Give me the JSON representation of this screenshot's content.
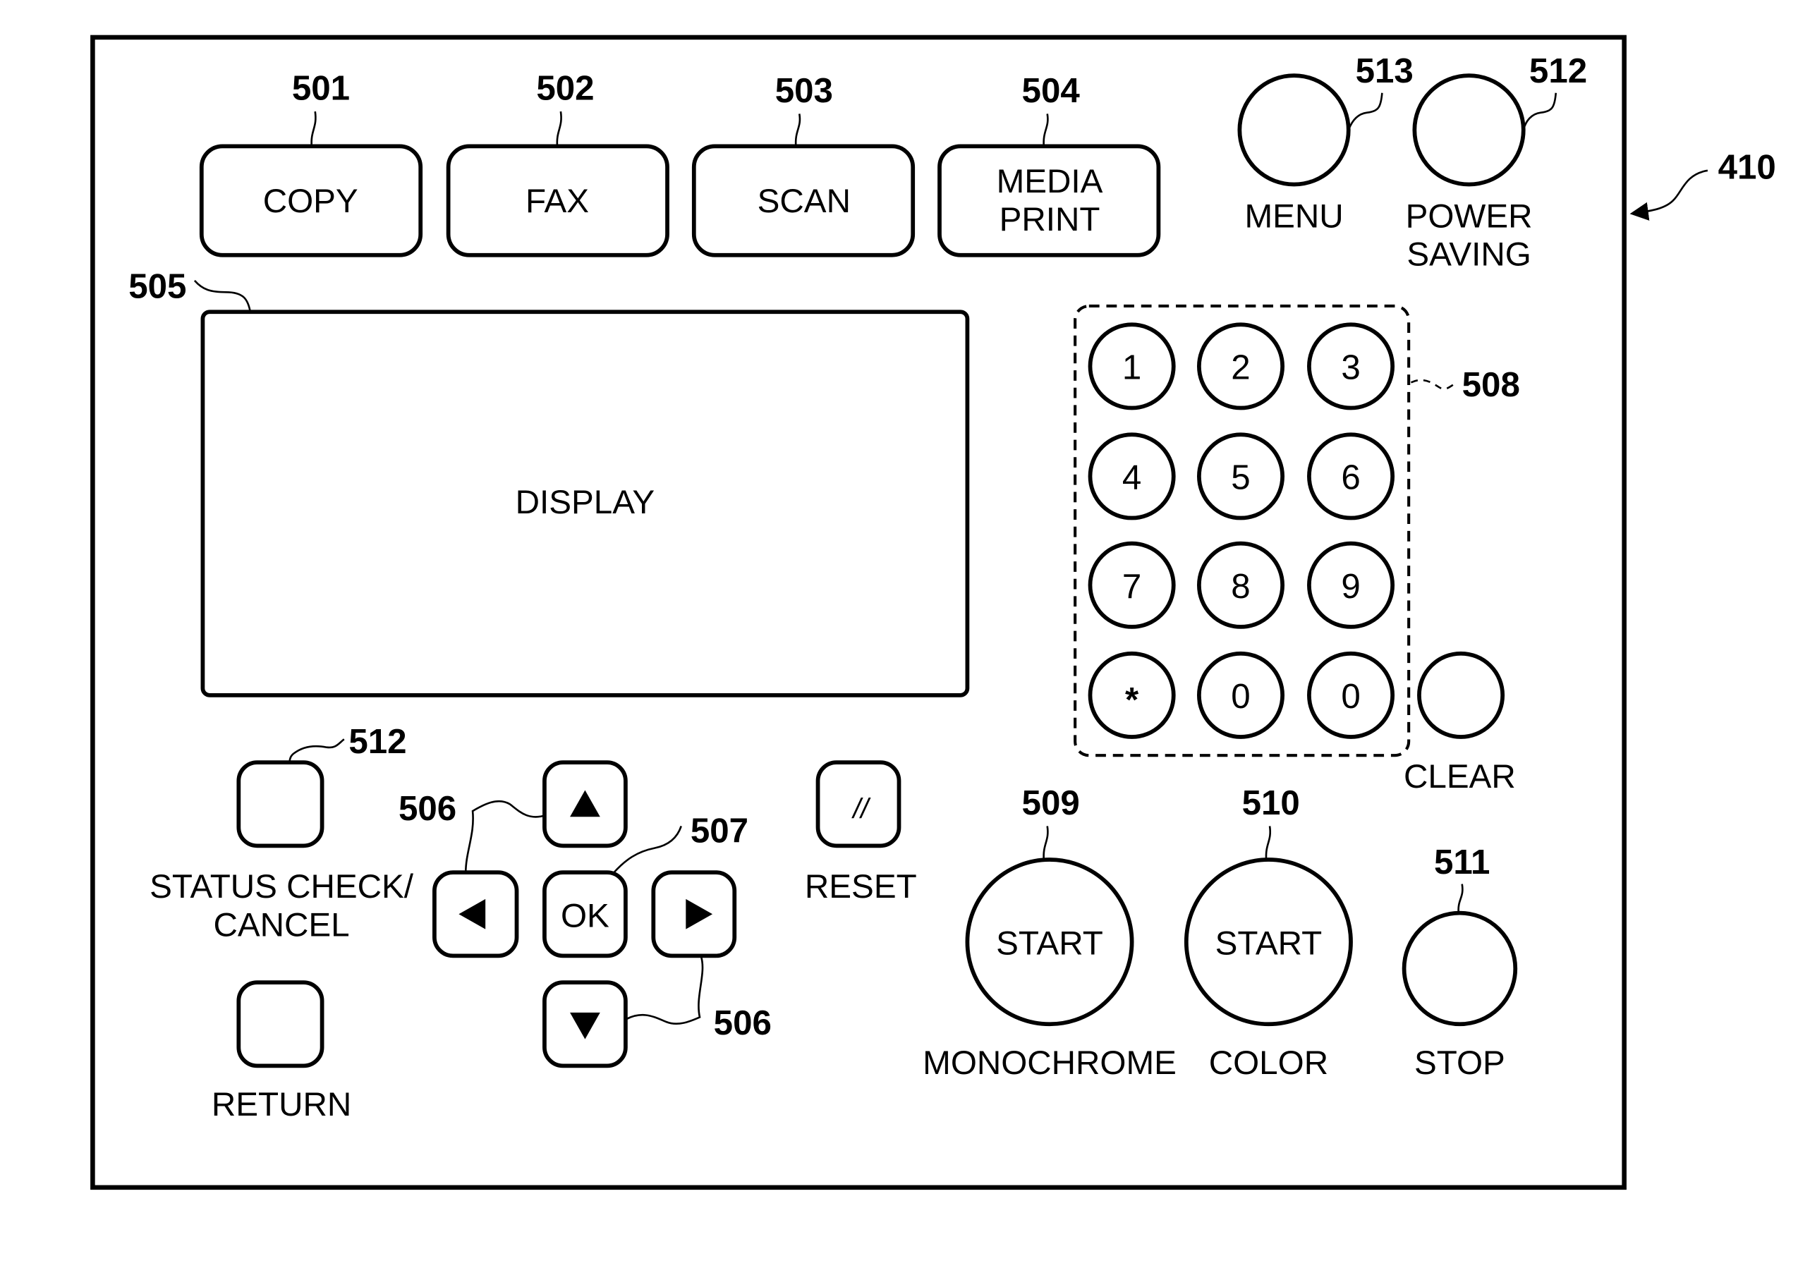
{
  "figure": {
    "panel_ref": "410",
    "colors": {
      "stroke": "#000000",
      "background": "#ffffff"
    }
  },
  "mode_buttons": [
    {
      "ref": "501",
      "label_lines": [
        "COPY"
      ]
    },
    {
      "ref": "502",
      "label_lines": [
        "FAX"
      ]
    },
    {
      "ref": "503",
      "label_lines": [
        "SCAN"
      ]
    },
    {
      "ref": "504",
      "label_lines": [
        "MEDIA",
        "PRINT"
      ]
    }
  ],
  "menu_button": {
    "ref": "513",
    "label": "MENU"
  },
  "power_saving_button": {
    "ref": "512",
    "label_lines": [
      "POWER",
      "SAVING"
    ]
  },
  "display": {
    "ref": "505",
    "label": "DISPLAY"
  },
  "keypad": {
    "ref": "508",
    "keys": [
      "1",
      "2",
      "3",
      "4",
      "5",
      "6",
      "7",
      "8",
      "9",
      "*",
      "0",
      "0"
    ]
  },
  "clear_button": {
    "label": "CLEAR"
  },
  "status_check_button": {
    "ref": "512",
    "label_lines": [
      "STATUS CHECK/",
      "CANCEL"
    ]
  },
  "return_button": {
    "label": "RETURN"
  },
  "arrow_keys": {
    "ref_upper": "506",
    "ref_lower": "506",
    "up_icon": "triangle-up",
    "down_icon": "triangle-down",
    "left_icon": "triangle-left",
    "right_icon": "triangle-right"
  },
  "ok_button": {
    "ref": "507",
    "label": "OK"
  },
  "reset_button": {
    "label": "RESET",
    "glyph": "//"
  },
  "start_mono_button": {
    "ref": "509",
    "label": "START",
    "caption": "MONOCHROME"
  },
  "start_color_button": {
    "ref": "510",
    "label": "START",
    "caption": "COLOR"
  },
  "stop_button": {
    "ref": "511",
    "label": "STOP"
  }
}
